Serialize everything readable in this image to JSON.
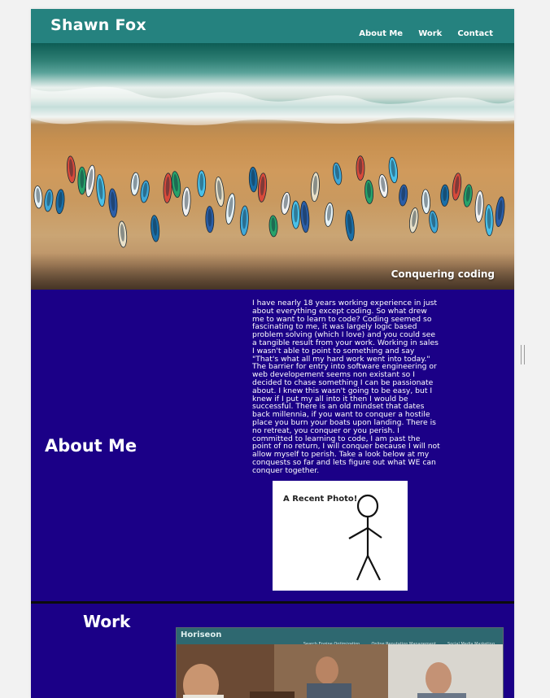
{
  "header": {
    "brand": "Shawn Fox",
    "nav": [
      "About Me",
      "Work",
      "Contact"
    ]
  },
  "hero": {
    "caption": "Conquering coding"
  },
  "about": {
    "heading": "About Me",
    "text": "I have nearly 18 years working experience in just about everything except coding. So what drew me to want to learn to code? Coding seemed so fascinating to me, it was largely logic based problem solving (which I love) and you could see a tangible result from your work. Working in sales I wasn't able to point to something and say \"That's what all my hard work went into today.\" The barrier for entry into software engineering or web developement seems non existant so I decided to chase something I can be passionate about. I knew this wasn't going to be easy, but I knew if I put my all into it then I would be successful. There is an old mindset that dates back millennia, if you want to conquer a hostile place you burn your boats upon landing. There is no retreat, you conquer or you perish. I committed to learning to code, I am past the point of no return, I will conquer because I will not allow myself to perish. Take a look below at my conquests so far and lets figure out what WE can conquer together.",
    "photo_caption": "A Recent Photo!"
  },
  "work": {
    "heading": "Work",
    "preview": {
      "logo": "Horiseon",
      "nav": [
        "Search Engine Optimization",
        "Online Reputation Management",
        "Social Media Marketing"
      ]
    }
  },
  "colors": {
    "header": "#25827f",
    "section_bg": "#1b0087",
    "page_bg": "#f2f2f2"
  }
}
